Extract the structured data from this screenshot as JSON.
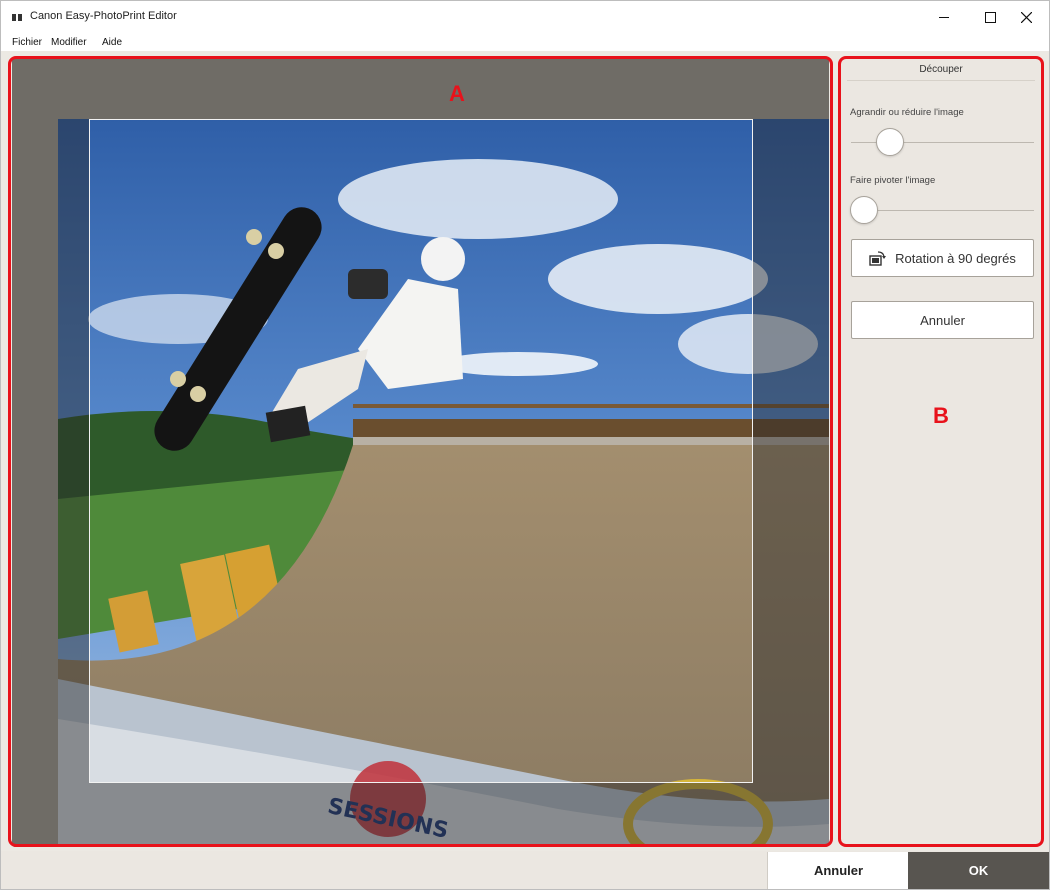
{
  "window": {
    "title": "Canon Easy-PhotoPrint Editor",
    "controls": {
      "minimize": "minimize-icon",
      "maximize": "maximize-icon",
      "close": "close-icon"
    }
  },
  "menu": {
    "items": [
      "Fichier",
      "Modifier",
      "Aide"
    ]
  },
  "annotations": {
    "a": "A",
    "b": "B",
    "accent_color": "#e8121b"
  },
  "preview": {
    "photo_description": "skateboarder-halfpipe-photo",
    "colors": {
      "background": "#6f6c66",
      "crop_border": "#f2f2f2"
    }
  },
  "panel": {
    "title": "Découper",
    "zoom_label": "Agrandir ou réduire l'image",
    "rotate_label": "Faire pivoter l'image",
    "rotate90_label": "Rotation à 90 degrés",
    "rotate90_icon": "rotate-90-icon",
    "cancel_label": "Annuler",
    "zoom_level": 0.22,
    "rotate_level": 0.0
  },
  "footer": {
    "cancel_label": "Annuler",
    "ok_label": "OK",
    "colors": {
      "ok_bg": "#585550",
      "ok_text": "#ffffff"
    }
  }
}
